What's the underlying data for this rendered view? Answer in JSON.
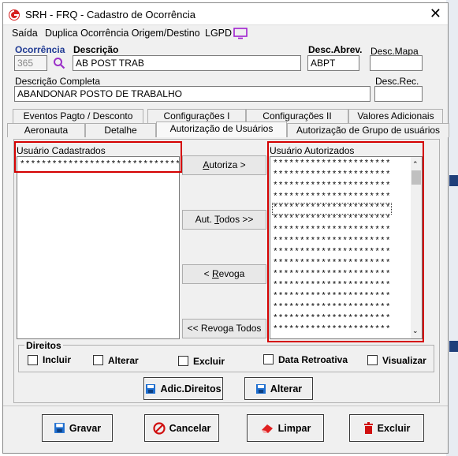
{
  "window": {
    "title": "SRH - FRQ - Cadastro de Ocorrência"
  },
  "menu": [
    "Saída",
    "Duplica Ocorrência Origem/Destino",
    "LGPD"
  ],
  "form": {
    "ocorrencia_label": "Ocorrência",
    "ocorrencia_value": "365",
    "descricao_label": "Descrição",
    "descricao_value": "AB POST TRAB",
    "desc_abrev_label": "Desc.Abrev.",
    "desc_abrev_value": "ABPT",
    "desc_mapa_label": "Desc.Mapa",
    "desc_mapa_value": "",
    "descricao_completa_label": "Descrição Completa",
    "descricao_completa_value": "ABANDONAR POSTO DE TRABALHO",
    "desc_rec_label": "Desc.Rec.",
    "desc_rec_value": ""
  },
  "tabs_row1": [
    "Eventos Pagto / Desconto",
    "Configurações I",
    "Configurações II",
    "Valores Adicionais"
  ],
  "tabs_row2": [
    "Aeronauta",
    "Detalhe",
    "Autorização de Usuários",
    "Autorização de Grupo de usuários"
  ],
  "panel": {
    "left_title": "Usuário Cadastrados",
    "left_items": [
      "******************************"
    ],
    "right_title": "Usuário Autorizados",
    "right_items": [
      "**********************",
      "**********************",
      "**********************",
      "**********************",
      "**********************",
      "**********************",
      "**********************",
      "**********************",
      "**********************",
      "**********************",
      "**********************",
      "**********************",
      "**********************",
      "**********************",
      "**********************",
      "**********************"
    ],
    "buttons": [
      "Autoriza >",
      "Aut. Todos >>",
      "< Revoga",
      "<< Revoga Todos"
    ]
  },
  "direitos": {
    "title": "Direitos",
    "options": [
      "Incluir",
      "Alterar",
      "Excluir",
      "Data Retroativa",
      "Visualizar"
    ]
  },
  "actions": {
    "adic_direitos": "Adic.Direitos",
    "alterar": "Alterar"
  },
  "footer": {
    "gravar": "Gravar",
    "cancelar": "Cancelar",
    "limpar": "Limpar",
    "excluir": "Excluir"
  }
}
